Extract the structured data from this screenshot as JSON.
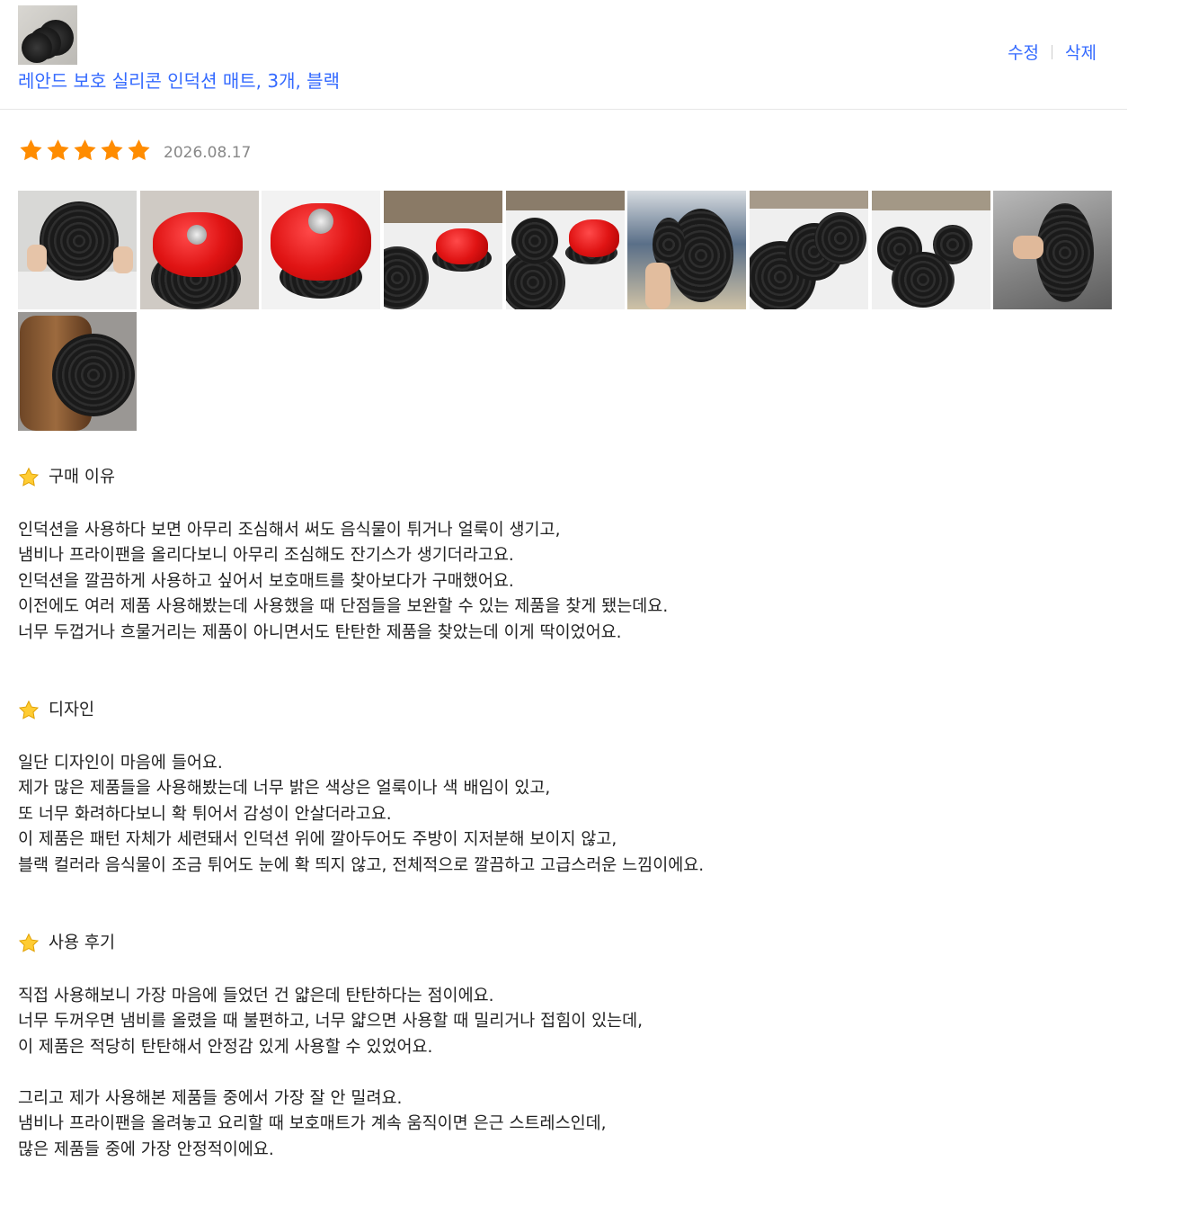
{
  "product": {
    "name": "레안드 보호 실리콘 인덕션 매트, 3개, 블랙",
    "thumbnail_icon": "silicone-mat-thumbnail"
  },
  "actions": {
    "edit_label": "수정",
    "delete_label": "삭제"
  },
  "colors": {
    "link": "#346aff",
    "star": "#ff8c00",
    "date": "#888888"
  },
  "review": {
    "rating": 5,
    "max_rating": 5,
    "date": "2026.08.17",
    "photo_count": 10,
    "sections": [
      {
        "title": "구매 이유",
        "lines": [
          "",
          "인덕션을 사용하다 보면 아무리 조심해서 써도 음식물이 튀거나 얼룩이 생기고,",
          "냄비나 프라이팬을 올리다보니 아무리 조심해도 잔기스가 생기더라고요.",
          "인덕션을 깔끔하게 사용하고 싶어서 보호매트를 찾아보다가 구매했어요.",
          "이전에도 여러 제품 사용해봤는데 사용했을 때 단점들을 보완할 수 있는 제품을 찾게 됐는데요.",
          "너무 두껍거나 흐물거리는 제품이 아니면서도 탄탄한 제품을 찾았는데 이게 딱이었어요."
        ]
      },
      {
        "title": "디자인",
        "lines": [
          "",
          "일단 디자인이 마음에 들어요.",
          "제가 많은 제품들을 사용해봤는데 너무 밝은 색상은 얼룩이나 색 배임이 있고,",
          "또 너무 화려하다보니 확 튀어서 감성이 안살더라고요.",
          "이 제품은 패턴 자체가 세련돼서 인덕션 위에 깔아두어도 주방이 지저분해 보이지 않고,",
          "블랙 컬러라 음식물이 조금 튀어도 눈에 확 띄지 않고, 전체적으로 깔끔하고 고급스러운 느낌이에요."
        ]
      },
      {
        "title": "사용 후기",
        "lines": [
          "",
          "직접 사용해보니 가장 마음에 들었던 건 얇은데 탄탄하다는 점이에요.",
          "너무 두꺼우면 냄비를 올렸을 때 불편하고, 너무 얇으면 사용할 때 밀리거나 접힘이 있는데,",
          "이 제품은 적당히 탄탄해서 안정감 있게 사용할 수 있었어요.",
          "",
          "그리고 제가 사용해본 제품들 중에서 가장 잘 안 밀려요.",
          "냄비나 프라이팬을 올려놓고 요리할 때 보호매트가 계속 움직이면 은근 스트레스인데,",
          "많은 제품들 중에 가장 안정적이에요."
        ]
      }
    ]
  }
}
